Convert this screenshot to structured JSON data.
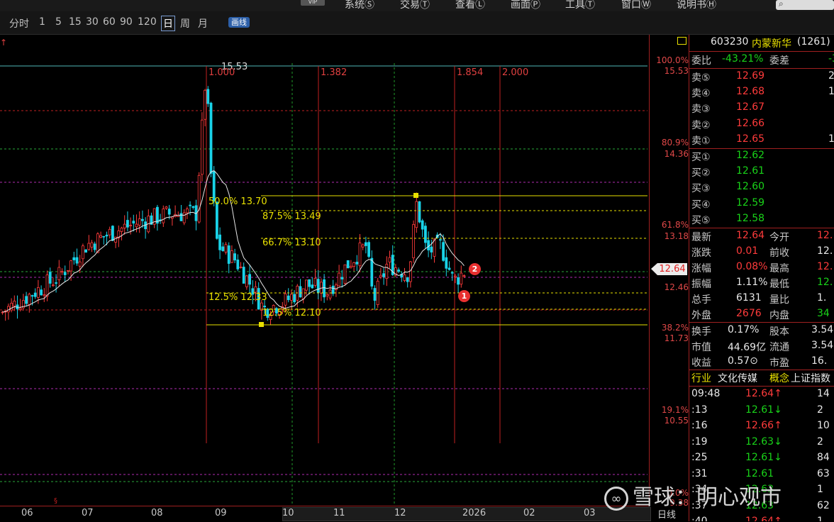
{
  "menubar": {
    "vip": "VIP",
    "items": [
      "系统Ⓢ",
      "交易Ⓣ",
      "查看Ⓛ",
      "画面Ⓟ",
      "工具Ⓣ",
      "窗口Ⓦ",
      "说明书Ⓗ"
    ]
  },
  "toolbar": {
    "periods": [
      "分时",
      "1",
      "5",
      "15",
      "30",
      "60",
      "90",
      "120",
      "日",
      "周",
      "月"
    ],
    "active_period": "日",
    "kline_button": "画线"
  },
  "chart": {
    "peak_label": "15.53",
    "fib_time_labels": [
      "1.000",
      "1.382",
      "1.854",
      "2.000"
    ],
    "fib_levels": [
      {
        "label": "50.0% 13.70"
      },
      {
        "label": "87.5% 13.49"
      },
      {
        "label": "66.7% 13.10"
      },
      {
        "label": "12.5% 12.33"
      },
      {
        "label": "12.5% 12.10"
      }
    ],
    "badges": [
      "2",
      "1"
    ],
    "right_axis": [
      {
        "pct": "100.0%",
        "price": "15.53"
      },
      {
        "pct": "80.9%",
        "price": "14.36"
      },
      {
        "pct": "61.8%",
        "price": "13.18"
      },
      {
        "pct": "",
        "price": "12.46"
      },
      {
        "pct": "38.2%",
        "price": "11.73"
      },
      {
        "pct": "19.1%",
        "price": "10.55"
      },
      {
        "pct": "0.0%",
        "price": "9.38"
      }
    ],
    "current_price": "12.64",
    "x_ticks": [
      "06",
      "07",
      "08",
      "09",
      "10",
      "11",
      "12",
      "2026",
      "02",
      "03"
    ],
    "period_label": "日线"
  },
  "panel": {
    "code": "603230",
    "name": "内蒙新华",
    "rank": "(1261)",
    "webi_label": "委比",
    "webi_value": "-43.21%",
    "weicha_label": "委差",
    "weicha_value": "-3",
    "asks": [
      {
        "label": "卖⑤",
        "price": "12.69",
        "vol": "2"
      },
      {
        "label": "卖④",
        "price": "12.68",
        "vol": "1"
      },
      {
        "label": "卖③",
        "price": "12.67",
        "vol": ""
      },
      {
        "label": "卖②",
        "price": "12.66",
        "vol": ""
      },
      {
        "label": "卖①",
        "price": "12.65",
        "vol": "1"
      }
    ],
    "bids": [
      {
        "label": "买①",
        "price": "12.62",
        "vol": ""
      },
      {
        "label": "买②",
        "price": "12.61",
        "vol": ""
      },
      {
        "label": "买③",
        "price": "12.60",
        "vol": ""
      },
      {
        "label": "买④",
        "price": "12.59",
        "vol": ""
      },
      {
        "label": "买⑤",
        "price": "12.58",
        "vol": ""
      }
    ],
    "stats": [
      {
        "l1": "最新",
        "v1": "12.64",
        "c1": "red",
        "l2": "今开",
        "v2": "12.",
        "c2": "red"
      },
      {
        "l1": "涨跌",
        "v1": "0.01",
        "c1": "red",
        "l2": "前收",
        "v2": "12.",
        "c2": "white"
      },
      {
        "l1": "涨幅",
        "v1": "0.08%",
        "c1": "red",
        "l2": "最高",
        "v2": "12.",
        "c2": "red"
      },
      {
        "l1": "振幅",
        "v1": "1.11%",
        "c1": "white",
        "l2": "最低",
        "v2": "12.",
        "c2": "green"
      },
      {
        "l1": "总手",
        "v1": "6131",
        "c1": "white",
        "l2": "量比",
        "v2": "1.",
        "c2": "white"
      },
      {
        "l1": "外盘",
        "v1": "2676",
        "c1": "red",
        "l2": "内盘",
        "v2": "34",
        "c2": "green"
      }
    ],
    "fund": [
      {
        "l1": "换手",
        "v1": "0.17%",
        "l2": "股本",
        "v2": "3.54"
      },
      {
        "l1": "市值",
        "v1": "44.69亿",
        "l2": "流通",
        "v2": "3.54"
      },
      {
        "l1": "收益",
        "v1": "0.57⊙",
        "l2": "市盈",
        "v2": "16."
      }
    ],
    "industry_label": "行业",
    "industry_value": "文化传媒",
    "concept_label": "概念",
    "concept_value": "上证指数",
    "ticks": [
      {
        "time": "09:48",
        "price": "12.64↑",
        "pc": "red",
        "vol": "14"
      },
      {
        "time": ":13",
        "price": "12.61↓",
        "pc": "green",
        "vol": "2"
      },
      {
        "time": ":16",
        "price": "12.66↑",
        "pc": "red",
        "vol": "10"
      },
      {
        "time": ":19",
        "price": "12.63↓",
        "pc": "green",
        "vol": "2"
      },
      {
        "time": ":25",
        "price": "12.61↓",
        "pc": "green",
        "vol": "84"
      },
      {
        "time": ":31",
        "price": "12.61",
        "pc": "green",
        "vol": "63"
      },
      {
        "time": ":34",
        "price": "12.63",
        "pc": "green",
        "vol": "1"
      },
      {
        "time": ":37",
        "price": "12.63",
        "pc": "green",
        "vol": "62"
      },
      {
        "time": ":40",
        "price": "12.64↑",
        "pc": "red",
        "vol": "1"
      }
    ]
  },
  "watermark": {
    "text": "雪球：明心观市",
    "logo": "∞"
  },
  "colors": {
    "up": "#ff3b3b",
    "down": "#19d3e8",
    "ma": "#e8e8e8",
    "fib_yellow": "#e8e000",
    "fib_time": "#c02020",
    "grid_green": "#1f9a2a",
    "grid_magenta": "#b02cb0"
  }
}
